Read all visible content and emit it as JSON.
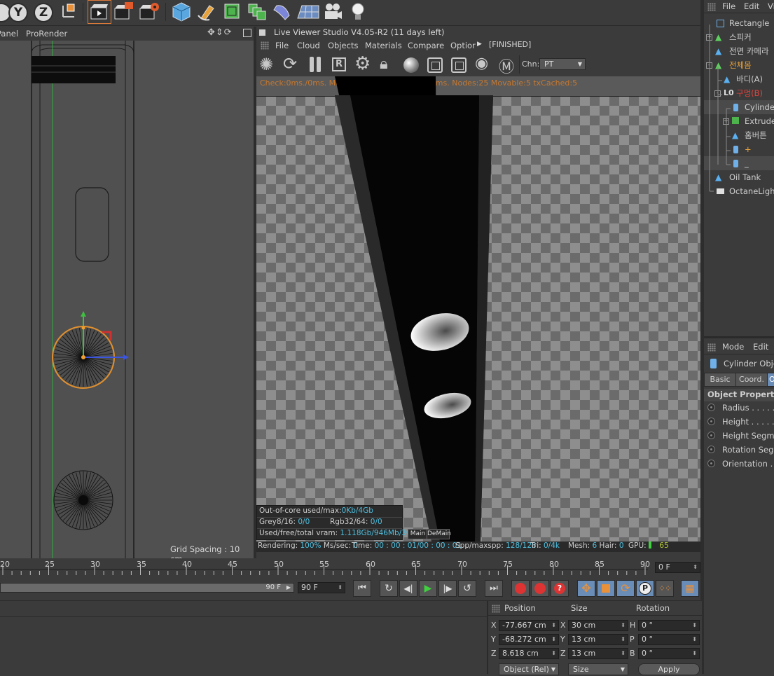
{
  "toolbar": {
    "axis_y": "Y",
    "axis_z": "Z",
    "icons": [
      "render-view-icon",
      "render-to-picture-viewer-icon",
      "render-settings-icon",
      "cube-icon",
      "pen-icon",
      "subdivision-icon",
      "array-icon",
      "deformer-icon",
      "floor-icon",
      "camera-icon",
      "light-icon"
    ]
  },
  "left_viewport": {
    "menu": [
      "Panel",
      "ProRender"
    ],
    "grid_spacing": "Grid Spacing : 10 cm"
  },
  "live_viewer": {
    "title": "Live Viewer Studio V4.05-R2 (11 days left)",
    "menu": [
      "File",
      "Cloud",
      "Objects",
      "Materials",
      "Compare",
      "Optior"
    ],
    "status": "[FINISHED]",
    "chn_label": "Chn:",
    "chn_value": "PT",
    "stats_line": "Check:0ms./0ms. MeshGen:0ms. Update[C]:0ms. Nodes:25 Movable:5 txCached:5",
    "ooc": "Out-of-core used/max:",
    "ooc_val": "0Kb/4Gb",
    "grey": "Grey8/16: ",
    "grey_val": "0/0",
    "rgb": "Rgb32/64: ",
    "rgb_val": "0/0",
    "vram": "Used/free/total vram: ",
    "vram_val": "1.118Gb/946Mb/3Gb",
    "tab_main": "Main",
    "tab_demain": "DeMain",
    "bottom": {
      "rendering": "Rendering: ",
      "rendering_val": "100%",
      "mssec": " Ms/sec: ",
      "mssec_val": "0",
      "time": "Time: ",
      "time_val": "00 : 00 : 01/00 : 00 : 01",
      "spp": "Spp/maxspp: ",
      "spp_val": "128/128",
      "tri": "Tri: ",
      "tri_val": "0/4k",
      "mesh": "Mesh: ",
      "mesh_val": "6",
      "hair": " Hair: ",
      "hair_val": "0",
      "gpu": "GPU:",
      "gpu_val": "65"
    }
  },
  "object_manager": {
    "menu": [
      "File",
      "Edit",
      "Vi"
    ],
    "items": [
      {
        "name": "Rectangle",
        "color": "#cfcfcf"
      },
      {
        "name": "스피커",
        "color": "#cfcfcf"
      },
      {
        "name": "전면 카메라",
        "color": "#cfcfcf"
      },
      {
        "name": "전체몸",
        "color": "#e8a23a"
      },
      {
        "name": "바디(A)",
        "color": "#cfcfcf"
      },
      {
        "name": "구멍(B)",
        "color": "#e0423c"
      },
      {
        "name": "Cylinder",
        "color": "#cfcfcf"
      },
      {
        "name": "Extrude",
        "color": "#cfcfcf"
      },
      {
        "name": "홈버튼",
        "color": "#cfcfcf"
      },
      {
        "name": "+",
        "color": "#e8a23a"
      },
      {
        "name": "_",
        "color": "#cfcfcf"
      },
      {
        "name": "Oil Tank",
        "color": "#cfcfcf"
      },
      {
        "name": "OctaneLight",
        "color": "#cfcfcf"
      }
    ]
  },
  "attributes": {
    "menu": [
      "Mode",
      "Edit"
    ],
    "object_title": "Cylinder Objec",
    "tabs": [
      "Basic",
      "Coord.",
      "O"
    ],
    "section": "Object Properties",
    "props": [
      "Radius . . . . . .",
      "Height . . . . . . .",
      "Height Segme",
      "Rotation Segm",
      "Orientation . . ."
    ]
  },
  "timeline": {
    "ticks": [
      "20",
      "25",
      "30",
      "35",
      "40",
      "45",
      "50",
      "55",
      "60",
      "65",
      "70",
      "75",
      "80",
      "85",
      "90"
    ],
    "frame_field": "0 F",
    "end_field_1": "90 F",
    "end_field_2": "90 F"
  },
  "coordinates": {
    "headers": {
      "position": "Position",
      "size": "Size",
      "rotation": "Rotation"
    },
    "rows": [
      {
        "axis": "X",
        "pos": "-77.667 cm",
        "saxis": "X",
        "size": "30 cm",
        "raxis": "H",
        "rot": "0 °"
      },
      {
        "axis": "Y",
        "pos": "-68.272 cm",
        "saxis": "Y",
        "size": "13 cm",
        "raxis": "P",
        "rot": "0 °"
      },
      {
        "axis": "Z",
        "pos": "8.618 cm",
        "saxis": "Z",
        "size": "13 cm",
        "raxis": "B",
        "rot": "0 °"
      }
    ],
    "mode_select": "Object (Rel)",
    "size_select": "Size",
    "apply": "Apply"
  }
}
